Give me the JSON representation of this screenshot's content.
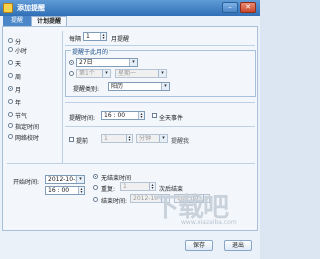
{
  "window": {
    "title": "添加提醒",
    "min_glyph": "–",
    "close_glyph": "✕"
  },
  "tabs": [
    {
      "label": "提醒"
    },
    {
      "label": "计划提醒"
    }
  ],
  "frequency_options": [
    {
      "label": "分",
      "selected": false
    },
    {
      "label": "小时",
      "selected": false
    },
    {
      "label": "天",
      "selected": false
    },
    {
      "label": "周",
      "selected": false
    },
    {
      "label": "月",
      "selected": true
    },
    {
      "label": "年",
      "selected": false
    },
    {
      "label": "节气",
      "selected": false
    },
    {
      "label": "指定时间",
      "selected": false
    },
    {
      "label": "网络校时",
      "selected": false
    }
  ],
  "interval": {
    "prefix": "每隔",
    "value": "1",
    "suffix": "月提醒"
  },
  "remind_on": {
    "title": "提醒于此月的",
    "day_value": "27日",
    "week_ordinal": "第1个",
    "weekday": "星期一",
    "type_label": "提醒类别:",
    "type_value": "阳历"
  },
  "remind_time": {
    "label": "提醒时间:",
    "value": "16 : 00",
    "allday_label": "全天事件"
  },
  "advance": {
    "label": "提前",
    "value": "1",
    "unit": "分钟",
    "suffix": "提醒我"
  },
  "range": {
    "start_label": "开始时间:",
    "start_date": "2012-10-27",
    "start_time": "16 : 00",
    "no_end_label": "无结束时间",
    "repeat_label": "重复:",
    "repeat_value": "1",
    "repeat_suffix": "次后结束",
    "end_label": "结束时间:",
    "end_date": "2012-10-28",
    "end_time": "16 : 00"
  },
  "buttons": {
    "save": "保存",
    "exit": "退出"
  },
  "watermark": {
    "mark": "下载吧",
    "url": "www.xiazaiba.com"
  }
}
